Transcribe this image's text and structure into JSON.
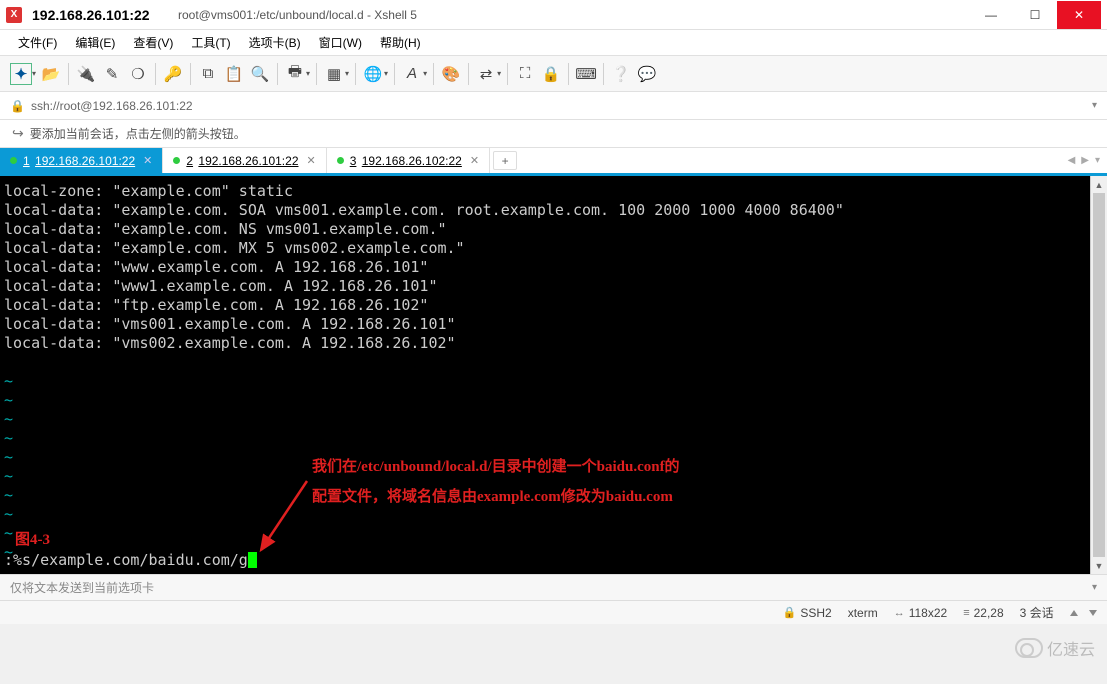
{
  "window": {
    "title": "192.168.26.101:22",
    "subtitle": "root@vms001:/etc/unbound/local.d - Xshell 5"
  },
  "menus": {
    "file": "文件(F)",
    "edit": "编辑(E)",
    "view": "查看(V)",
    "tools": "工具(T)",
    "tabs": "选项卡(B)",
    "window": "窗口(W)",
    "help": "帮助(H)"
  },
  "address": {
    "url": "ssh://root@192.168.26.101:22"
  },
  "hint": {
    "text": "要添加当前会话，点击左侧的箭头按钮。"
  },
  "tabs": [
    {
      "num": "1",
      "label": "192.168.26.101:22",
      "active": true
    },
    {
      "num": "2",
      "label": "192.168.26.101:22",
      "active": false
    },
    {
      "num": "3",
      "label": "192.168.26.102:22",
      "active": false
    }
  ],
  "terminal": {
    "lines": [
      "local-zone: \"example.com\" static",
      "local-data: \"example.com. SOA vms001.example.com. root.example.com. 100 2000 1000 4000 86400\"",
      "local-data: \"example.com. NS vms001.example.com.\"",
      "local-data: \"example.com. MX 5 vms002.example.com.\"",
      "local-data: \"www.example.com. A 192.168.26.101\"",
      "local-data: \"www1.example.com. A 192.168.26.101\"",
      "local-data: \"ftp.example.com. A 192.168.26.102\"",
      "local-data: \"vms001.example.com. A 192.168.26.101\"",
      "local-data: \"vms002.example.com. A 192.168.26.102\""
    ],
    "annotation_line1": "我们在/etc/unbound/local.d/目录中创建一个baidu.conf的",
    "annotation_line2": "配置文件，将域名信息由example.com修改为baidu.com",
    "figure_label": "图4-3",
    "command": ":%s/example.com/baidu.com/g"
  },
  "sendbar": {
    "text": "仅将文本发送到当前选项卡"
  },
  "status": {
    "protocol": "SSH2",
    "termtype": "xterm",
    "size": "118x22",
    "cursor": "22,28",
    "sessions": "3 会话"
  },
  "watermark": {
    "text": "亿速云"
  }
}
